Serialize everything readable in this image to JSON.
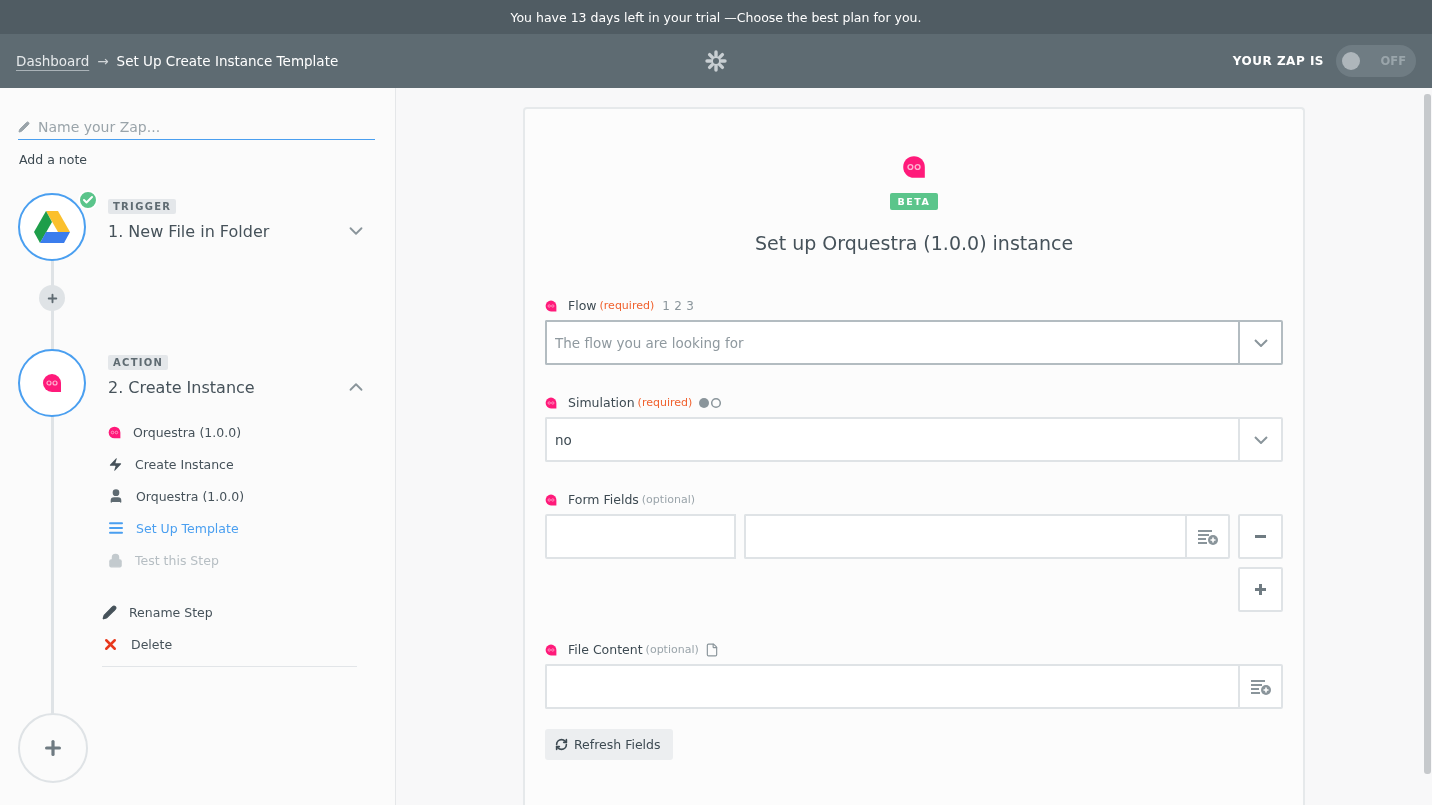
{
  "trial_bar": {
    "text": "You have 13 days left in your trial",
    "link": "—Choose the best plan for you."
  },
  "header": {
    "breadcrumb_link": "Dashboard",
    "separator": "→",
    "title": "Set Up Create Instance Template",
    "status_label": "YOUR ZAP IS",
    "toggle": {
      "on": false,
      "label": "OFF"
    }
  },
  "sidebar": {
    "name_field": {
      "placeholder": "Name your Zap..."
    },
    "add_note": "Add a note",
    "steps": [
      {
        "badge": "TRIGGER",
        "title": "1. New File in Folder",
        "kind": "drive",
        "complete": true,
        "expanded": false
      },
      {
        "badge": "ACTION",
        "title": "2. Create Instance",
        "kind": "orquestra",
        "complete": false,
        "expanded": true,
        "substeps": [
          {
            "kind": "app",
            "label": "Orquestra (1.0.0)",
            "selected": false,
            "disabled": false
          },
          {
            "kind": "action",
            "label": "Create Instance",
            "selected": false,
            "disabled": false
          },
          {
            "kind": "account",
            "label": "Orquestra (1.0.0)",
            "selected": false,
            "disabled": false
          },
          {
            "kind": "template",
            "label": "Set Up Template",
            "selected": true,
            "disabled": false
          },
          {
            "kind": "test",
            "label": "Test this Step",
            "selected": false,
            "disabled": true
          }
        ],
        "actions": [
          {
            "kind": "rename",
            "label": "Rename Step"
          },
          {
            "kind": "delete",
            "label": "Delete"
          }
        ]
      }
    ]
  },
  "card": {
    "badge": "BETA",
    "heading": "Set up Orquestra (1.0.0) instance",
    "fields": [
      {
        "kind": "select",
        "label": "Flow",
        "requirement": "(required)",
        "required": true,
        "extra": "1 2 3",
        "placeholder": "The flow you are looking for"
      },
      {
        "kind": "select",
        "label": "Simulation",
        "requirement": "(required)",
        "required": true,
        "toggle_hint": true,
        "value": "no"
      },
      {
        "kind": "pairs",
        "label": "Form Fields",
        "requirement": "(optional)",
        "required": false
      },
      {
        "kind": "text",
        "label": "File Content",
        "requirement": "(optional)",
        "required": false,
        "file_hint": true
      }
    ],
    "refresh_button": "Refresh Fields"
  }
}
